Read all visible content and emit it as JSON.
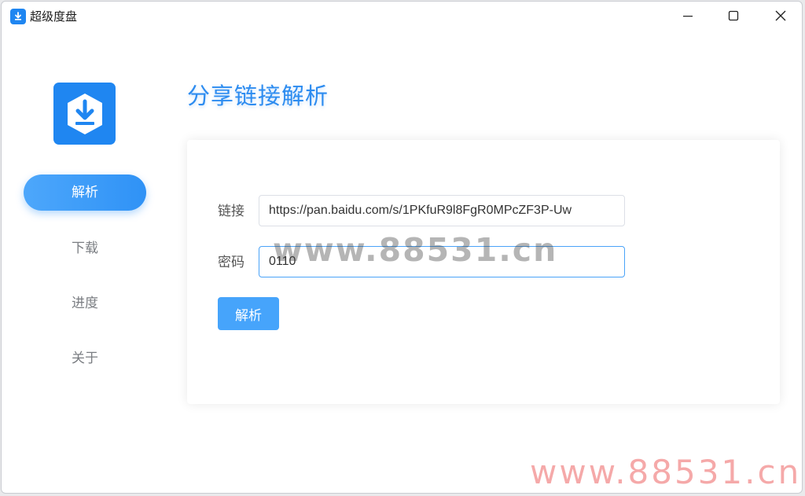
{
  "window": {
    "title": "超级度盘",
    "controls": {
      "minimize_icon": "minimize-icon",
      "maximize_icon": "maximize-icon",
      "close_icon": "close-icon"
    }
  },
  "sidebar": {
    "logo_icon": "download-icon",
    "items": [
      {
        "label": "解析",
        "active": true
      },
      {
        "label": "下载",
        "active": false
      },
      {
        "label": "进度",
        "active": false
      },
      {
        "label": "关于",
        "active": false
      }
    ]
  },
  "main": {
    "title": "分享链接解析",
    "form": {
      "link_label": "链接",
      "link_value": "https://pan.baidu.com/s/1PKfuR9l8FgR0MPcZF3P-Uw",
      "password_label": "密码",
      "password_value": "0110",
      "submit_label": "解析"
    }
  },
  "watermarks": {
    "center": "www.88531.cn",
    "bottom": "www.88531.cn"
  },
  "colors": {
    "accent": "#2d8cf0",
    "button": "#46a4fb",
    "focus_border": "#4aa3f8",
    "watermark_bottom": "#f28c8c"
  }
}
